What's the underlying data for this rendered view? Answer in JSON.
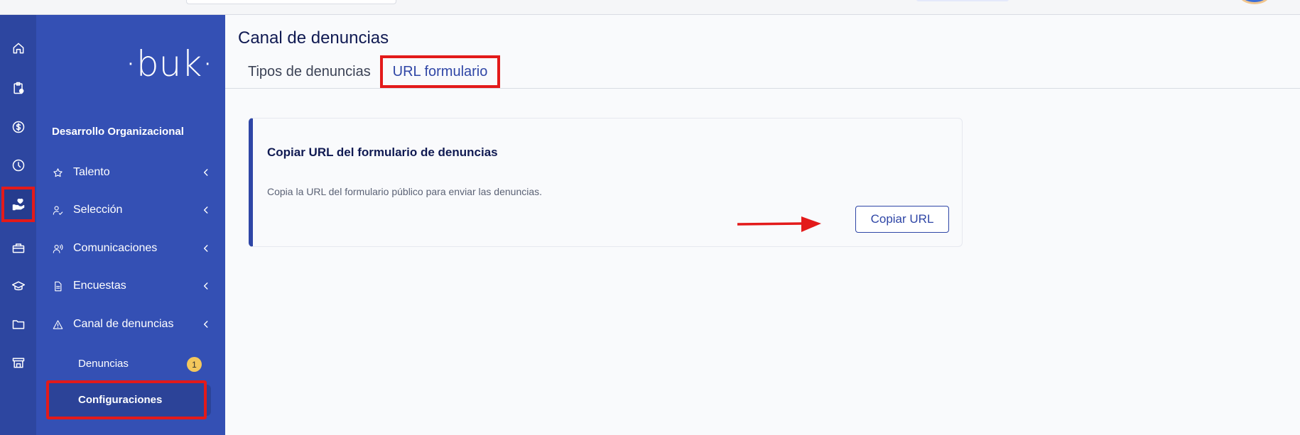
{
  "sidebar": {
    "logo_text": "·buk·",
    "section_title": "Desarrollo Organizacional",
    "items": [
      {
        "label": "Talento",
        "icon": "star-icon"
      },
      {
        "label": "Selección",
        "icon": "user-check-icon"
      },
      {
        "label": "Comunicaciones",
        "icon": "users-voice-icon"
      },
      {
        "label": "Encuestas",
        "icon": "document-icon"
      },
      {
        "label": "Canal de denuncias",
        "icon": "warning-triangle-icon"
      }
    ],
    "sub_items": [
      {
        "label": "Denuncias",
        "badge": "1"
      },
      {
        "label": "Configuraciones"
      }
    ]
  },
  "rail": {
    "icons": [
      "home-icon",
      "clipboard-icon",
      "dollar-coin-icon",
      "clock-icon",
      "hand-heart-icon",
      "gift-icon",
      "graduation-cap-icon",
      "folder-icon",
      "store-icon"
    ],
    "active": "hand-heart-icon"
  },
  "main": {
    "title": "Canal de denuncias",
    "tabs": [
      {
        "label": "Tipos de denuncias",
        "active": false
      },
      {
        "label": "URL formulario",
        "active": true
      }
    ],
    "card": {
      "title": "Copiar URL del formulario de denuncias",
      "description": "Copia la URL del formulario público para enviar las denuncias.",
      "button_label": "Copiar URL"
    }
  },
  "colors": {
    "rail_bg": "#2d46a0",
    "sidebar_bg": "#3450b4",
    "accent": "#2f46a6",
    "highlight": "#e31a1a",
    "badge": "#f3c75c"
  }
}
